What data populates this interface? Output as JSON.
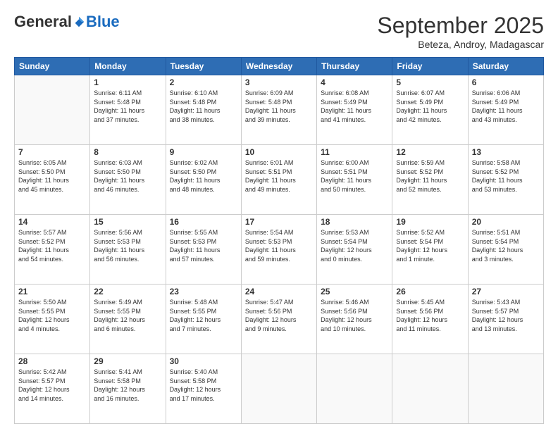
{
  "header": {
    "logo_general": "General",
    "logo_blue": "Blue",
    "month_title": "September 2025",
    "subtitle": "Beteza, Androy, Madagascar"
  },
  "days_of_week": [
    "Sunday",
    "Monday",
    "Tuesday",
    "Wednesday",
    "Thursday",
    "Friday",
    "Saturday"
  ],
  "weeks": [
    [
      {
        "day": "",
        "info": ""
      },
      {
        "day": "1",
        "info": "Sunrise: 6:11 AM\nSunset: 5:48 PM\nDaylight: 11 hours\nand 37 minutes."
      },
      {
        "day": "2",
        "info": "Sunrise: 6:10 AM\nSunset: 5:48 PM\nDaylight: 11 hours\nand 38 minutes."
      },
      {
        "day": "3",
        "info": "Sunrise: 6:09 AM\nSunset: 5:48 PM\nDaylight: 11 hours\nand 39 minutes."
      },
      {
        "day": "4",
        "info": "Sunrise: 6:08 AM\nSunset: 5:49 PM\nDaylight: 11 hours\nand 41 minutes."
      },
      {
        "day": "5",
        "info": "Sunrise: 6:07 AM\nSunset: 5:49 PM\nDaylight: 11 hours\nand 42 minutes."
      },
      {
        "day": "6",
        "info": "Sunrise: 6:06 AM\nSunset: 5:49 PM\nDaylight: 11 hours\nand 43 minutes."
      }
    ],
    [
      {
        "day": "7",
        "info": "Sunrise: 6:05 AM\nSunset: 5:50 PM\nDaylight: 11 hours\nand 45 minutes."
      },
      {
        "day": "8",
        "info": "Sunrise: 6:03 AM\nSunset: 5:50 PM\nDaylight: 11 hours\nand 46 minutes."
      },
      {
        "day": "9",
        "info": "Sunrise: 6:02 AM\nSunset: 5:50 PM\nDaylight: 11 hours\nand 48 minutes."
      },
      {
        "day": "10",
        "info": "Sunrise: 6:01 AM\nSunset: 5:51 PM\nDaylight: 11 hours\nand 49 minutes."
      },
      {
        "day": "11",
        "info": "Sunrise: 6:00 AM\nSunset: 5:51 PM\nDaylight: 11 hours\nand 50 minutes."
      },
      {
        "day": "12",
        "info": "Sunrise: 5:59 AM\nSunset: 5:52 PM\nDaylight: 11 hours\nand 52 minutes."
      },
      {
        "day": "13",
        "info": "Sunrise: 5:58 AM\nSunset: 5:52 PM\nDaylight: 11 hours\nand 53 minutes."
      }
    ],
    [
      {
        "day": "14",
        "info": "Sunrise: 5:57 AM\nSunset: 5:52 PM\nDaylight: 11 hours\nand 54 minutes."
      },
      {
        "day": "15",
        "info": "Sunrise: 5:56 AM\nSunset: 5:53 PM\nDaylight: 11 hours\nand 56 minutes."
      },
      {
        "day": "16",
        "info": "Sunrise: 5:55 AM\nSunset: 5:53 PM\nDaylight: 11 hours\nand 57 minutes."
      },
      {
        "day": "17",
        "info": "Sunrise: 5:54 AM\nSunset: 5:53 PM\nDaylight: 11 hours\nand 59 minutes."
      },
      {
        "day": "18",
        "info": "Sunrise: 5:53 AM\nSunset: 5:54 PM\nDaylight: 12 hours\nand 0 minutes."
      },
      {
        "day": "19",
        "info": "Sunrise: 5:52 AM\nSunset: 5:54 PM\nDaylight: 12 hours\nand 1 minute."
      },
      {
        "day": "20",
        "info": "Sunrise: 5:51 AM\nSunset: 5:54 PM\nDaylight: 12 hours\nand 3 minutes."
      }
    ],
    [
      {
        "day": "21",
        "info": "Sunrise: 5:50 AM\nSunset: 5:55 PM\nDaylight: 12 hours\nand 4 minutes."
      },
      {
        "day": "22",
        "info": "Sunrise: 5:49 AM\nSunset: 5:55 PM\nDaylight: 12 hours\nand 6 minutes."
      },
      {
        "day": "23",
        "info": "Sunrise: 5:48 AM\nSunset: 5:55 PM\nDaylight: 12 hours\nand 7 minutes."
      },
      {
        "day": "24",
        "info": "Sunrise: 5:47 AM\nSunset: 5:56 PM\nDaylight: 12 hours\nand 9 minutes."
      },
      {
        "day": "25",
        "info": "Sunrise: 5:46 AM\nSunset: 5:56 PM\nDaylight: 12 hours\nand 10 minutes."
      },
      {
        "day": "26",
        "info": "Sunrise: 5:45 AM\nSunset: 5:56 PM\nDaylight: 12 hours\nand 11 minutes."
      },
      {
        "day": "27",
        "info": "Sunrise: 5:43 AM\nSunset: 5:57 PM\nDaylight: 12 hours\nand 13 minutes."
      }
    ],
    [
      {
        "day": "28",
        "info": "Sunrise: 5:42 AM\nSunset: 5:57 PM\nDaylight: 12 hours\nand 14 minutes."
      },
      {
        "day": "29",
        "info": "Sunrise: 5:41 AM\nSunset: 5:58 PM\nDaylight: 12 hours\nand 16 minutes."
      },
      {
        "day": "30",
        "info": "Sunrise: 5:40 AM\nSunset: 5:58 PM\nDaylight: 12 hours\nand 17 minutes."
      },
      {
        "day": "",
        "info": ""
      },
      {
        "day": "",
        "info": ""
      },
      {
        "day": "",
        "info": ""
      },
      {
        "day": "",
        "info": ""
      }
    ]
  ]
}
